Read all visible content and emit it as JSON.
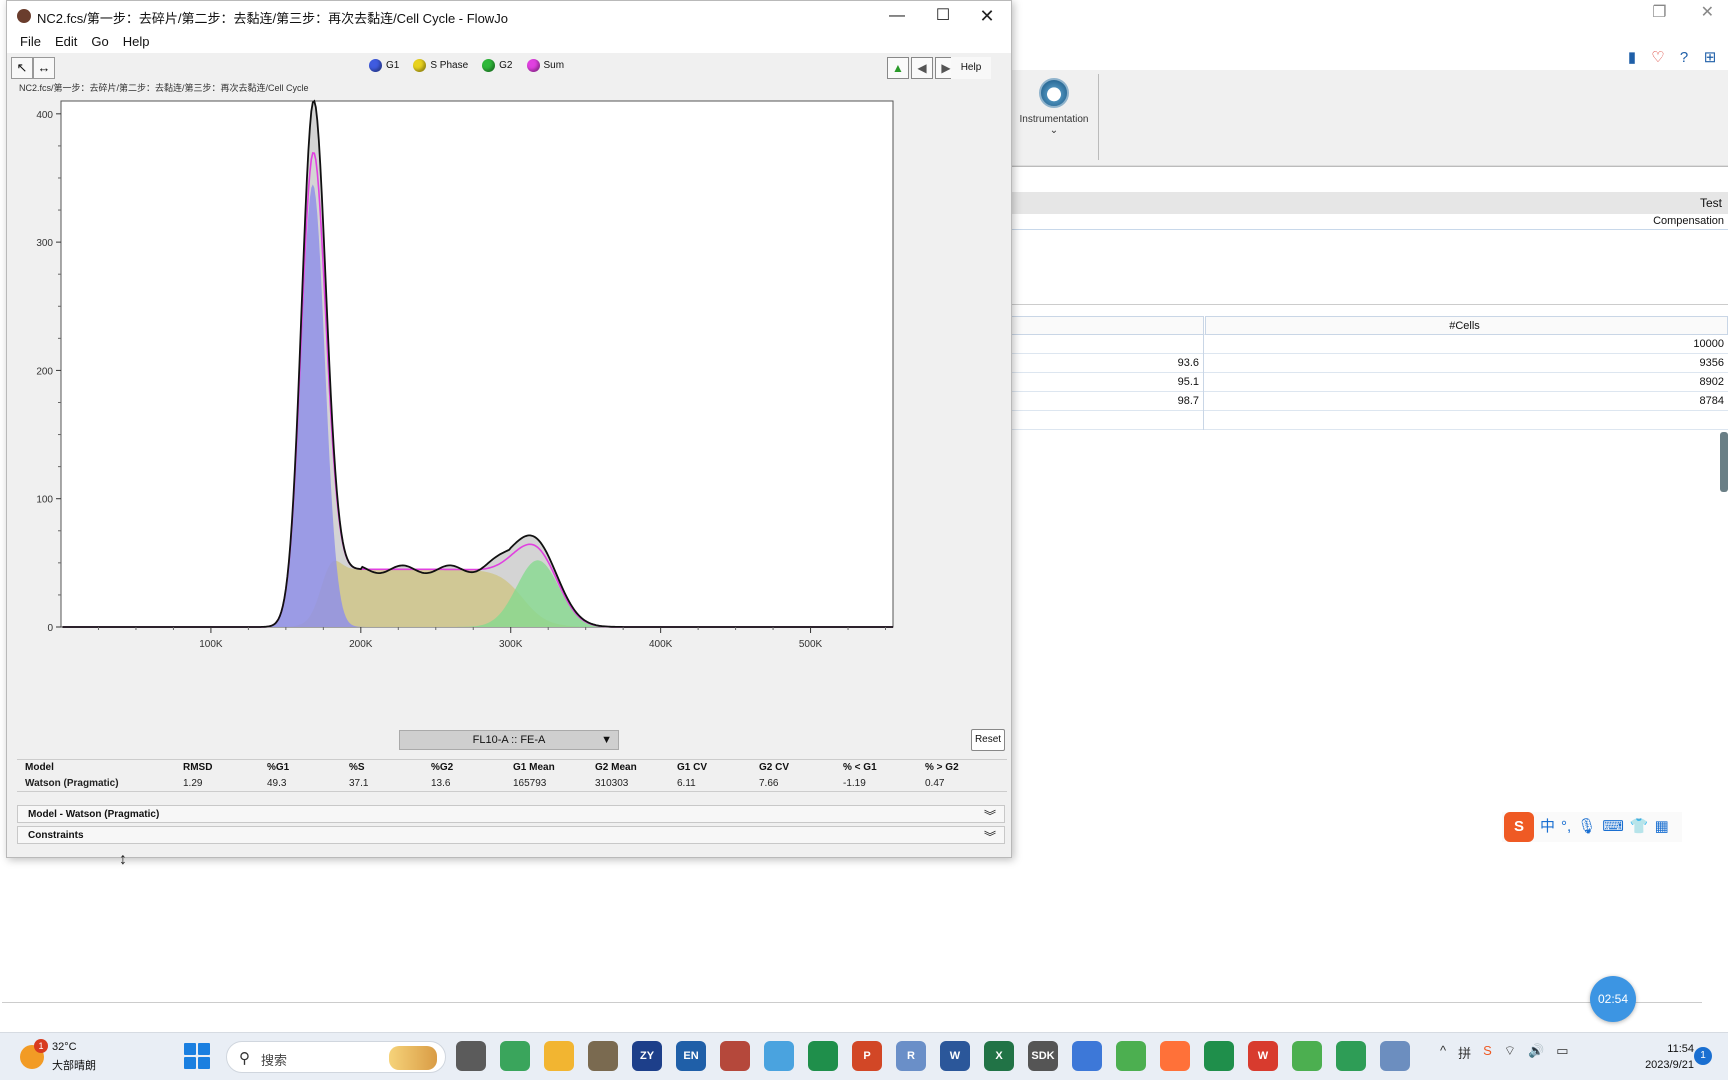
{
  "window": {
    "title": "NC2.fcs/第一步：去碎片/第二步：去黏连/第三步：再次去黏连/Cell Cycle - FlowJo",
    "menu": [
      "File",
      "Edit",
      "Go",
      "Help"
    ],
    "path": "NC2.fcs/第一步：去碎片/第二步：去黏连/第三步：再次去黏连/Cell Cycle",
    "help_label": "Help",
    "axis_parameter": "FL10-A :: FE-A",
    "reset_label": "Reset"
  },
  "legend": [
    {
      "name": "G1",
      "color": "#3f5be0"
    },
    {
      "name": "S Phase",
      "color": "#e8d21e"
    },
    {
      "name": "G2",
      "color": "#2fb83a"
    },
    {
      "name": "Sum",
      "color": "#e040e0"
    }
  ],
  "chart_data": {
    "type": "area",
    "x_ticks": [
      "100K",
      "200K",
      "300K",
      "400K",
      "500K"
    ],
    "y_ticks": [
      "0",
      "100",
      "200",
      "300",
      "400"
    ],
    "xlim": [
      0,
      555000
    ],
    "ylim": [
      0,
      410
    ],
    "series": [
      {
        "name": "G1",
        "color": "#9090e8",
        "peak_x": 168000,
        "peak_y": 345,
        "sd": 8000
      },
      {
        "name": "S Phase",
        "color": "#cfc68a",
        "plateau_y": 45,
        "x_range": [
          172000,
          308000
        ]
      },
      {
        "name": "G2",
        "color": "#86d98e",
        "peak_x": 318000,
        "peak_y": 52,
        "sd": 14000
      },
      {
        "name": "Sum",
        "color": "#e040e0",
        "peak_x": 168000,
        "peak_y": 357
      },
      {
        "name": "Data",
        "color": "#111111",
        "peak_x": 170000,
        "peak_y": 398
      }
    ]
  },
  "stats": {
    "headers": [
      "Model",
      "RMSD",
      "%G1",
      "%S",
      "%G2",
      "G1 Mean",
      "G2 Mean",
      "G1 CV",
      "G2 CV",
      "% < G1",
      "% > G2"
    ],
    "row": [
      "Watson (Pragmatic)",
      "1.29",
      "49.3",
      "37.1",
      "13.6",
      "165793",
      "310303",
      "6.11",
      "7.66",
      "-1.19",
      "0.47"
    ]
  },
  "panels": {
    "model": "Model - Watson (Pragmatic)",
    "constraints": "Constraints"
  },
  "background": {
    "ribbon_label": "Instrumentation",
    "header_right": "Test",
    "compensation": "Compensation",
    "table_head": "#Cells",
    "table_rows": [
      {
        "pct": "",
        "cells": "10000"
      },
      {
        "pct": "93.6",
        "cells": "9356"
      },
      {
        "pct": "95.1",
        "cells": "8902"
      },
      {
        "pct": "98.7",
        "cells": "8784"
      },
      {
        "pct": "",
        "cells": ""
      }
    ]
  },
  "ime": {
    "logo": "S",
    "mode": "中"
  },
  "timer": "02:54",
  "taskbar": {
    "weather_temp": "32°C",
    "weather_cond": "大部晴朗",
    "weather_badge": "1",
    "search_placeholder": "搜索",
    "apps": [
      {
        "label": "",
        "color": "#5b5b5b"
      },
      {
        "label": "",
        "color": "#3aa55c"
      },
      {
        "label": "",
        "color": "#f2b531"
      },
      {
        "label": "",
        "color": "#7a6a50"
      },
      {
        "label": "ZY",
        "color": "#1d3f8a"
      },
      {
        "label": "EN",
        "color": "#1f5fa8"
      },
      {
        "label": "",
        "color": "#b5483b"
      },
      {
        "label": "",
        "color": "#4aa3df"
      },
      {
        "label": "",
        "color": "#1f8f4b"
      },
      {
        "label": "P",
        "color": "#d24726"
      },
      {
        "label": "R",
        "color": "#6a8fc8"
      },
      {
        "label": "W",
        "color": "#2b579a"
      },
      {
        "label": "X",
        "color": "#217346"
      },
      {
        "label": "SDK",
        "color": "#555555"
      },
      {
        "label": "",
        "color": "#3d78d8"
      },
      {
        "label": "",
        "color": "#4caf50"
      },
      {
        "label": "",
        "color": "#ff7139"
      },
      {
        "label": "",
        "color": "#1f8f4b"
      },
      {
        "label": "W",
        "color": "#d83b2e"
      },
      {
        "label": "",
        "color": "#4caf50"
      },
      {
        "label": "",
        "color": "#2e9d56"
      },
      {
        "label": "",
        "color": "#6c8ebf"
      }
    ],
    "time": "11:54",
    "date": "2023/9/21",
    "notif": "1"
  }
}
